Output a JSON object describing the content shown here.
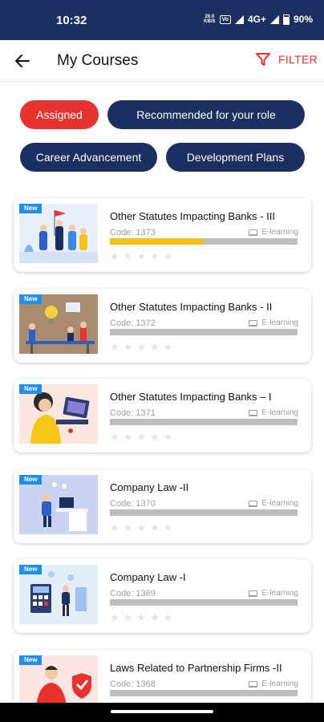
{
  "status_bar": {
    "time": "10:32",
    "data_rate_top": "26.0",
    "data_rate_bottom": "KB/S",
    "network_label": "Vo",
    "network_type": "4G+",
    "battery": "90%"
  },
  "app_bar": {
    "title": "My Courses",
    "filter_label": "FILTER"
  },
  "filters": [
    {
      "label": "Assigned",
      "active": true
    },
    {
      "label": "Recommended for your role",
      "active": false
    },
    {
      "label": "Career Advancement",
      "active": false
    },
    {
      "label": "Development Plans",
      "active": false
    }
  ],
  "courses": [
    {
      "badge": "New",
      "title": "Other Statutes Impacting Banks - III",
      "code": "Code: 1373",
      "type": "E-learning",
      "progress": 0.5,
      "rating": 0,
      "illustration": "team-with-flag"
    },
    {
      "badge": "New",
      "title": "Other Statutes Impacting Banks - II",
      "code": "Code: 1372",
      "type": "E-learning",
      "progress": 0,
      "rating": 0,
      "illustration": "team-meeting-lightbulb"
    },
    {
      "badge": "New",
      "title": "Other Statutes Impacting Banks – I",
      "code": "Code: 1371",
      "type": "E-learning",
      "progress": 0,
      "rating": 0,
      "illustration": "woman-with-laptop"
    },
    {
      "badge": "New",
      "title": "Company Law -II",
      "code": "Code: 1370",
      "type": "E-learning",
      "progress": 0,
      "rating": 0,
      "illustration": "person-at-desk"
    },
    {
      "badge": "New",
      "title": "Company Law -I",
      "code": "Code: 1369",
      "type": "E-learning",
      "progress": 0,
      "rating": 0,
      "illustration": "person-with-calculator"
    },
    {
      "badge": "New",
      "title": "Laws Related to Partnership Firms -II",
      "code": "Code: 1368",
      "type": "E-learning",
      "progress": 0,
      "rating": 0,
      "illustration": "man-with-shield"
    }
  ],
  "colors": {
    "primary": "#1b3060",
    "accent": "#e8322f",
    "badge": "#1f8ef0",
    "progress": "#f2c21a"
  }
}
